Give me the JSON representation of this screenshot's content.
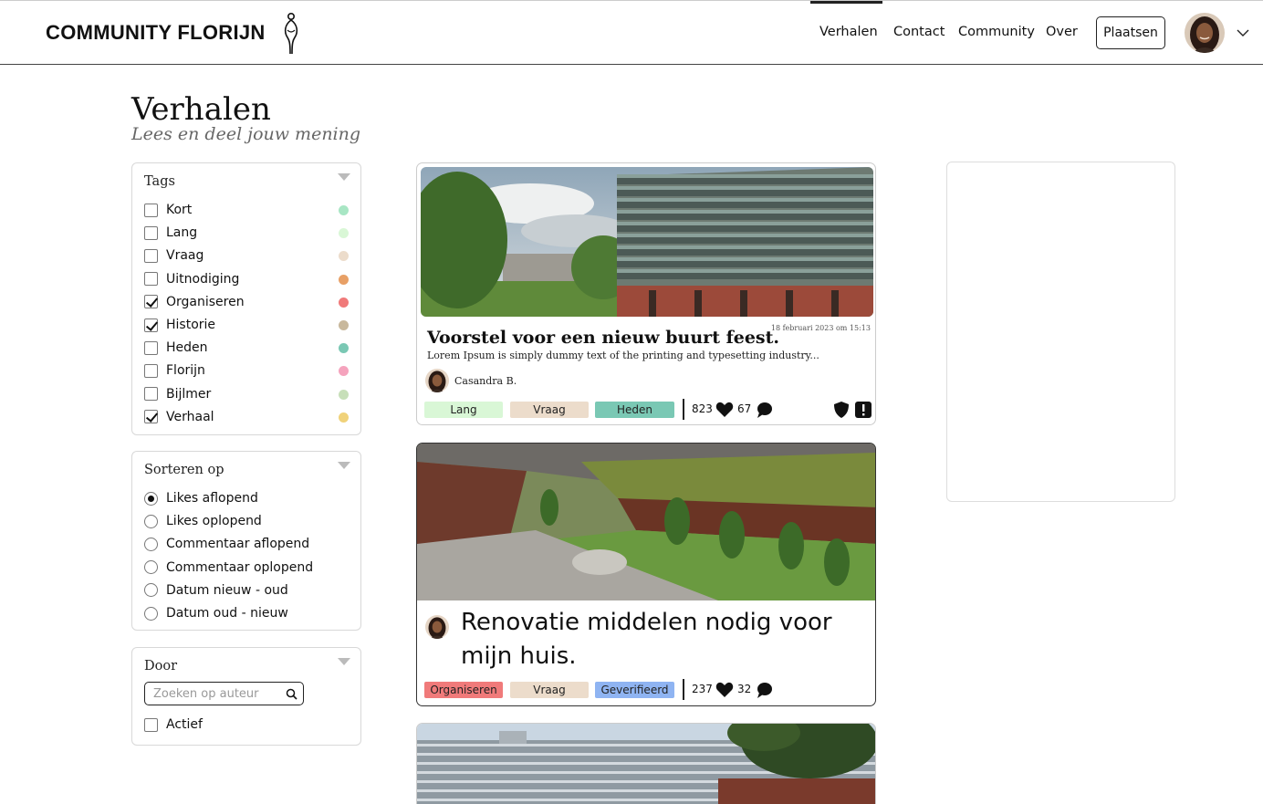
{
  "header": {
    "brand": "COMMUNITY FLORIJN",
    "nav": [
      "Verhalen",
      "Contact",
      "Community",
      "Over"
    ],
    "post_label": "Plaatsen"
  },
  "page": {
    "title": "Verhalen",
    "subtitle": "Lees en deel jouw mening"
  },
  "tags_panel": {
    "title": "Tags",
    "items": [
      {
        "label": "Kort",
        "checked": false,
        "color": "#a8e6c4"
      },
      {
        "label": "Lang",
        "checked": false,
        "color": "#d9f7d6"
      },
      {
        "label": "Vraag",
        "checked": false,
        "color": "#ecdccb"
      },
      {
        "label": "Uitnodiging",
        "checked": false,
        "color": "#e8a066"
      },
      {
        "label": "Organiseren",
        "checked": true,
        "color": "#f07a7a"
      },
      {
        "label": "Historie",
        "checked": true,
        "color": "#c8b89c"
      },
      {
        "label": "Heden",
        "checked": false,
        "color": "#7ac8b4"
      },
      {
        "label": "Florijn",
        "checked": false,
        "color": "#f5a3bd"
      },
      {
        "label": "Bijlmer",
        "checked": false,
        "color": "#c7dfb9"
      },
      {
        "label": "Verhaal",
        "checked": true,
        "color": "#f0d27a"
      }
    ]
  },
  "sort_panel": {
    "title": "Sorteren op",
    "options": [
      {
        "label": "Likes aflopend",
        "selected": true
      },
      {
        "label": "Likes oplopend",
        "selected": false
      },
      {
        "label": "Commentaar aflopend",
        "selected": false
      },
      {
        "label": "Commentaar oplopend",
        "selected": false
      },
      {
        "label": "Datum nieuw - oud",
        "selected": false
      },
      {
        "label": "Datum oud - nieuw",
        "selected": false
      }
    ]
  },
  "author_panel": {
    "title": "Door",
    "search_placeholder": "Zoeken op auteur",
    "active_label": "Actief"
  },
  "posts": [
    {
      "title": "Voorstel voor een nieuw buurt feest.",
      "date": "18 februari 2023 om 15:13",
      "excerpt": "Lorem Ipsum is simply dummy text of the printing and typesetting industry...",
      "author": "Casandra B.",
      "tags": [
        {
          "label": "Lang",
          "color": "#d9f7d6"
        },
        {
          "label": "Vraag",
          "color": "#ecdccb"
        },
        {
          "label": "Heden",
          "color": "#7ac8b4"
        }
      ],
      "likes": "823",
      "comments": "67"
    },
    {
      "title": "Renovatie middelen nodig voor mijn huis.",
      "tags": [
        {
          "label": "Organiseren",
          "color": "#f07a7a"
        },
        {
          "label": "Vraag",
          "color": "#ecdccb"
        },
        {
          "label": "Geverifieerd",
          "color": "#8fb4f2"
        }
      ],
      "likes": "237",
      "comments": "32"
    }
  ]
}
